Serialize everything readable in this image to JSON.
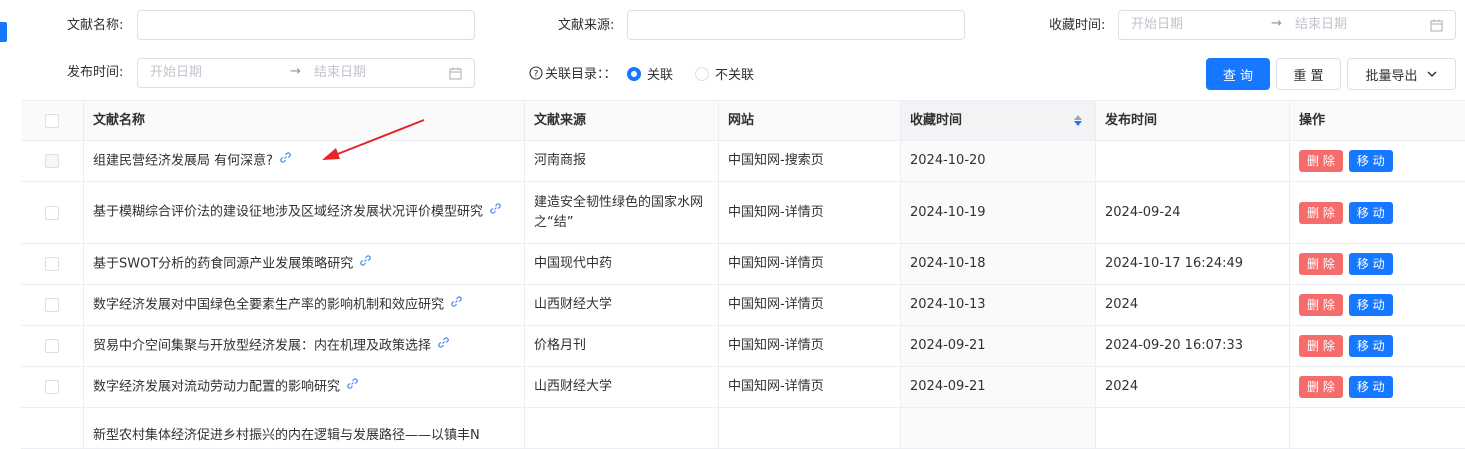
{
  "filters": {
    "title_label": "文献名称:",
    "source_label": "文献来源:",
    "fav_time_label": "收藏时间:",
    "pub_time_label": "发布时间:",
    "start_placeholder": "开始日期",
    "end_placeholder": "结束日期",
    "related_label": "关联目录：：",
    "related_options": [
      "关联",
      "不关联"
    ],
    "related_selected": "关联"
  },
  "buttons": {
    "query": "查 询",
    "reset": "重 置",
    "export": "批量导出"
  },
  "table": {
    "columns": [
      "文献名称",
      "文献来源",
      "网站",
      "收藏时间",
      "发布时间",
      "操作"
    ],
    "row_actions": {
      "delete": "删 除",
      "move": "移 动"
    },
    "rows": [
      {
        "title": "组建民营经济发展局 有何深意?",
        "source": "河南商报",
        "site": "中国知网-搜索页",
        "fav_time": "2024-10-20",
        "pub_time": ""
      },
      {
        "title": "基于模糊综合评价法的建设征地涉及区域经济发展状况评价模型研究",
        "source": "建造安全韧性绿色的国家水网之“结”",
        "site": "中国知网-详情页",
        "fav_time": "2024-10-19",
        "pub_time": "2024-09-24"
      },
      {
        "title": "基于SWOT分析的药食同源产业发展策略研究",
        "source": "中国现代中药",
        "site": "中国知网-详情页",
        "fav_time": "2024-10-18",
        "pub_time": "2024-10-17 16:24:49"
      },
      {
        "title": "数字经济发展对中国绿色全要素生产率的影响机制和效应研究",
        "source": "山西财经大学",
        "site": "中国知网-详情页",
        "fav_time": "2024-10-13",
        "pub_time": "2024"
      },
      {
        "title": "贸易中介空间集聚与开放型经济发展：内在机理及政策选择",
        "source": "价格月刊",
        "site": "中国知网-详情页",
        "fav_time": "2024-09-21",
        "pub_time": "2024-09-20 16:07:33"
      },
      {
        "title": "数字经济发展对流动劳动力配置的影响研究",
        "source": "山西财经大学",
        "site": "中国知网-详情页",
        "fav_time": "2024-09-21",
        "pub_time": "2024"
      },
      {
        "title": "新型农村集体经济促进乡村振兴的内在逻辑与发展路径——以镇丰N",
        "source": "",
        "site": "",
        "fav_time": "",
        "pub_time": ""
      }
    ]
  },
  "colors": {
    "primary": "#1677ff",
    "danger": "#f56c6c",
    "annotation_arrow": "#e8242b"
  }
}
